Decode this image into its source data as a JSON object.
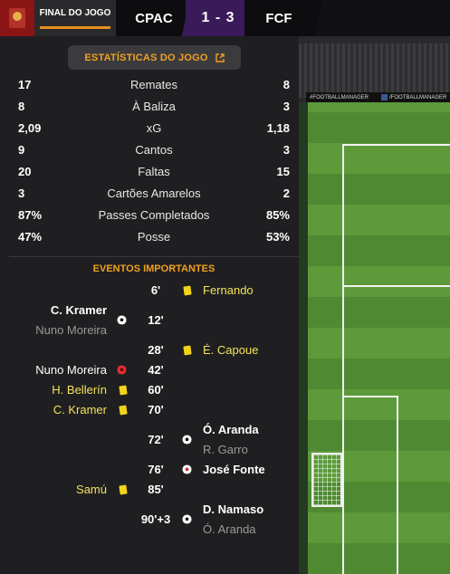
{
  "header": {
    "final_label": "FINAL DO JOGO",
    "home_team": "CPAC",
    "score": "1 - 3",
    "away_team": "FCF"
  },
  "stats_button": {
    "label": "ESTATÍSTICAS DO JOGO"
  },
  "stats": [
    {
      "home": "17",
      "label": "Remates",
      "away": "8"
    },
    {
      "home": "8",
      "label": "À Baliza",
      "away": "3"
    },
    {
      "home": "2,09",
      "label": "xG",
      "away": "1,18"
    },
    {
      "home": "9",
      "label": "Cantos",
      "away": "3"
    },
    {
      "home": "20",
      "label": "Faltas",
      "away": "15"
    },
    {
      "home": "3",
      "label": "Cartões Amarelos",
      "away": "2"
    },
    {
      "home": "87%",
      "label": "Passes Completados",
      "away": "85%"
    },
    {
      "home": "47%",
      "label": "Posse",
      "away": "53%"
    }
  ],
  "events_title": "EVENTOS IMPORTANTES",
  "events": [
    {
      "minute": "6'",
      "type": "yellow-card",
      "side": "away",
      "player": "Fernando"
    },
    {
      "minute": "12'",
      "type": "goal",
      "side": "home",
      "player": "C. Kramer",
      "assist": "Nuno Moreira"
    },
    {
      "minute": "28'",
      "type": "yellow-card",
      "side": "away",
      "player": "É. Capoue"
    },
    {
      "minute": "42'",
      "type": "injury-substitution",
      "side": "home",
      "player": "Nuno Moreira"
    },
    {
      "minute": "60'",
      "type": "yellow-card",
      "side": "home",
      "player": "H. Bellerín"
    },
    {
      "minute": "70'",
      "type": "yellow-card",
      "side": "home",
      "player": "C. Kramer"
    },
    {
      "minute": "72'",
      "type": "goal",
      "side": "away",
      "player": "Ó. Aranda",
      "assist": "R. Garro"
    },
    {
      "minute": "76'",
      "type": "own-goal",
      "side": "away",
      "player": "José Fonte"
    },
    {
      "minute": "85'",
      "type": "yellow-card",
      "side": "home",
      "player": "Samú"
    },
    {
      "minute": "90'+3",
      "type": "goal",
      "side": "away",
      "player": "D. Namaso",
      "assist": "Ó. Aranda"
    }
  ],
  "pitch": {
    "ad_1": "#FOOTBALLMANAGER",
    "ad_2": "/FOOTBALLMANAGER"
  },
  "colors": {
    "accent": "#f0a020",
    "yellow_text": "#f4e25c",
    "score_bg": "#3a1a58",
    "club_red": "#8b1414"
  }
}
